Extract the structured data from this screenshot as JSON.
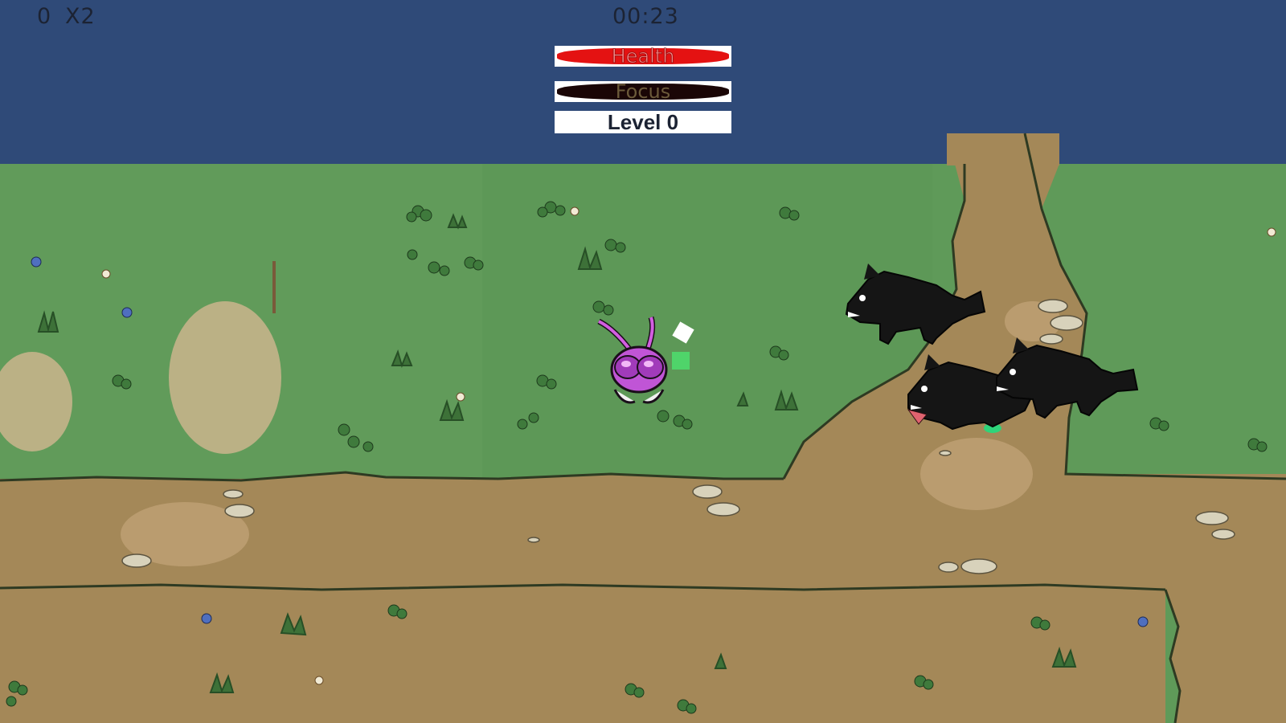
{
  "hud": {
    "score": "0",
    "multiplier": "X2",
    "timer": "00:23",
    "health": {
      "label": "Health",
      "fraction": 1.0
    },
    "focus": {
      "label": "Focus",
      "fraction": 1.0
    },
    "level": "Level 0"
  },
  "colors": {
    "sky": "#2f4a78",
    "grass": "#5f9a59",
    "dirt": "#a48858",
    "health": "#e41212",
    "focus": "#1a0606"
  },
  "entities": {
    "player": "purple-bug-player",
    "enemies": [
      "black-wolf",
      "black-wolf",
      "black-wolf"
    ],
    "pickups": [
      "white-xp-gem",
      "green-xp-gem"
    ]
  }
}
